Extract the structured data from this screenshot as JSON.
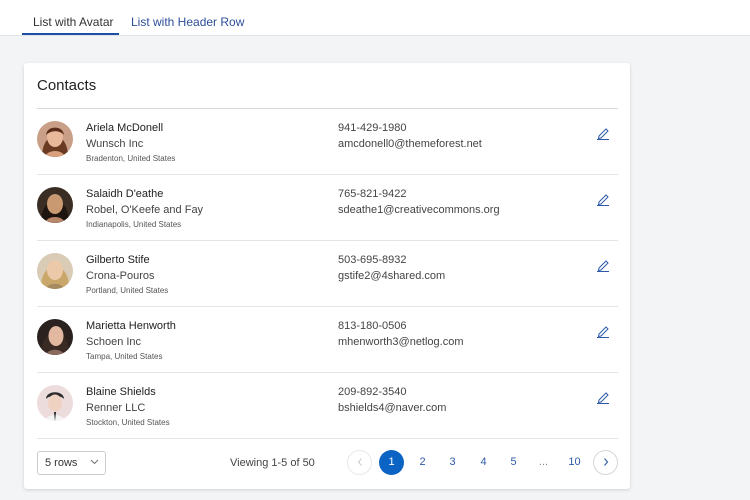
{
  "tabs": [
    {
      "label": "List with Avatar",
      "active": true
    },
    {
      "label": "List with Header Row",
      "active": false
    }
  ],
  "card": {
    "title": "Contacts"
  },
  "contacts": [
    {
      "name": "Ariela McDonell",
      "company": "Wunsch Inc",
      "location": "Bradenton, United States",
      "phone": "941-429-1980",
      "email": "amcdonell0@themeforest.net"
    },
    {
      "name": "Salaidh D'eathe",
      "company": "Robel, O'Keefe and Fay",
      "location": "Indianapolis, United States",
      "phone": "765-821-9422",
      "email": "sdeathe1@creativecommons.org"
    },
    {
      "name": "Gilberto Stife",
      "company": "Crona-Pouros",
      "location": "Portland, United States",
      "phone": "503-695-8932",
      "email": "gstife2@4shared.com"
    },
    {
      "name": "Marietta Henworth",
      "company": "Schoen Inc",
      "location": "Tampa, United States",
      "phone": "813-180-0506",
      "email": "mhenworth3@netlog.com"
    },
    {
      "name": "Blaine Shields",
      "company": "Renner LLC",
      "location": "Stockton, United States",
      "phone": "209-892-3540",
      "email": "bshields4@naver.com"
    }
  ],
  "footer": {
    "rows_select": "5 rows",
    "viewing": "Viewing 1-5 of 50",
    "pages": [
      "1",
      "2",
      "3",
      "4",
      "5",
      "...",
      "10"
    ],
    "current_page": "1"
  },
  "icons": {
    "edit": "pencil-icon",
    "prev": "chevron-left-icon",
    "next": "chevron-right-icon",
    "select": "chevron-down-icon"
  },
  "colors": {
    "accent": "#0b63c4",
    "link": "#2d4f9a",
    "tab_underline": "#1d4fa6"
  }
}
